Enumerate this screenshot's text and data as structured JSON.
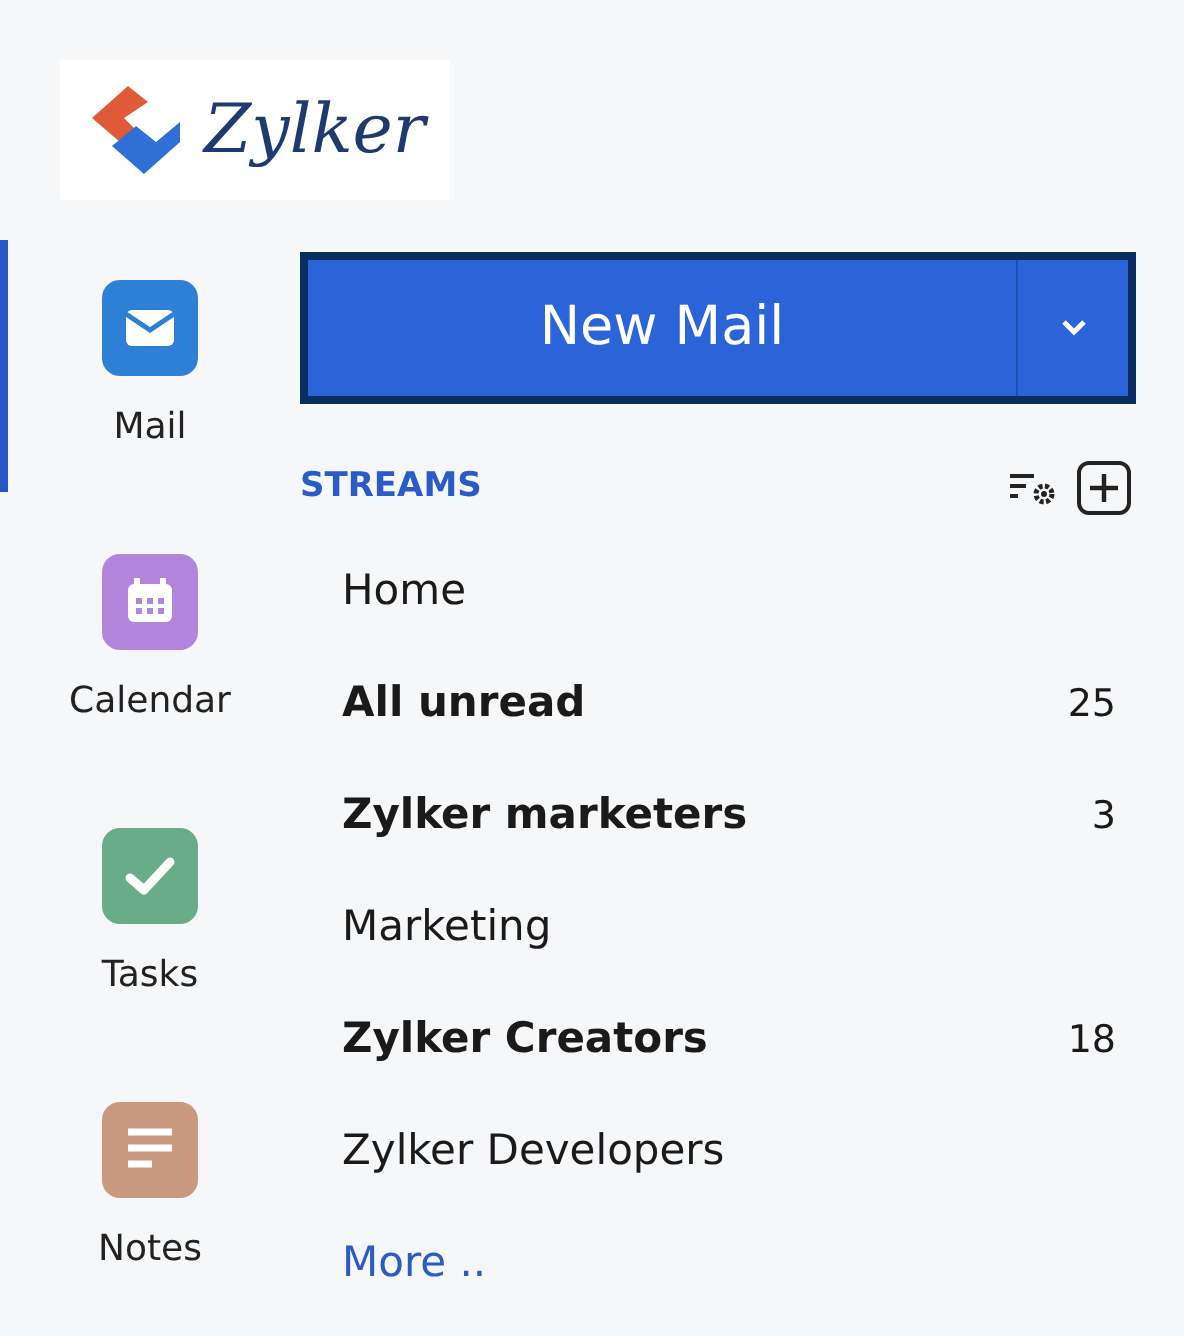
{
  "logo": {
    "text": "Zylker"
  },
  "apps": [
    {
      "label": "Mail",
      "selected": true,
      "kind": "mail",
      "color": "#2e7fd6"
    },
    {
      "label": "Calendar",
      "selected": false,
      "kind": "calendar",
      "color": "#b085db"
    },
    {
      "label": "Tasks",
      "selected": false,
      "kind": "tasks",
      "color": "#68ac88"
    },
    {
      "label": "Notes",
      "selected": false,
      "kind": "notes",
      "color": "#c9997f"
    }
  ],
  "new_mail_button": {
    "label": "New Mail"
  },
  "streams": {
    "title": "STREAMS",
    "items": [
      {
        "label": "Home",
        "unread": false
      },
      {
        "label": "All unread",
        "unread": true,
        "count": "25"
      },
      {
        "label": "Zylker marketers",
        "unread": true,
        "count": "3"
      },
      {
        "label": "Marketing",
        "unread": false
      },
      {
        "label": "Zylker Creators",
        "unread": true,
        "count": "18"
      },
      {
        "label": "Zylker Developers",
        "unread": false
      }
    ],
    "more_link": "More .."
  }
}
